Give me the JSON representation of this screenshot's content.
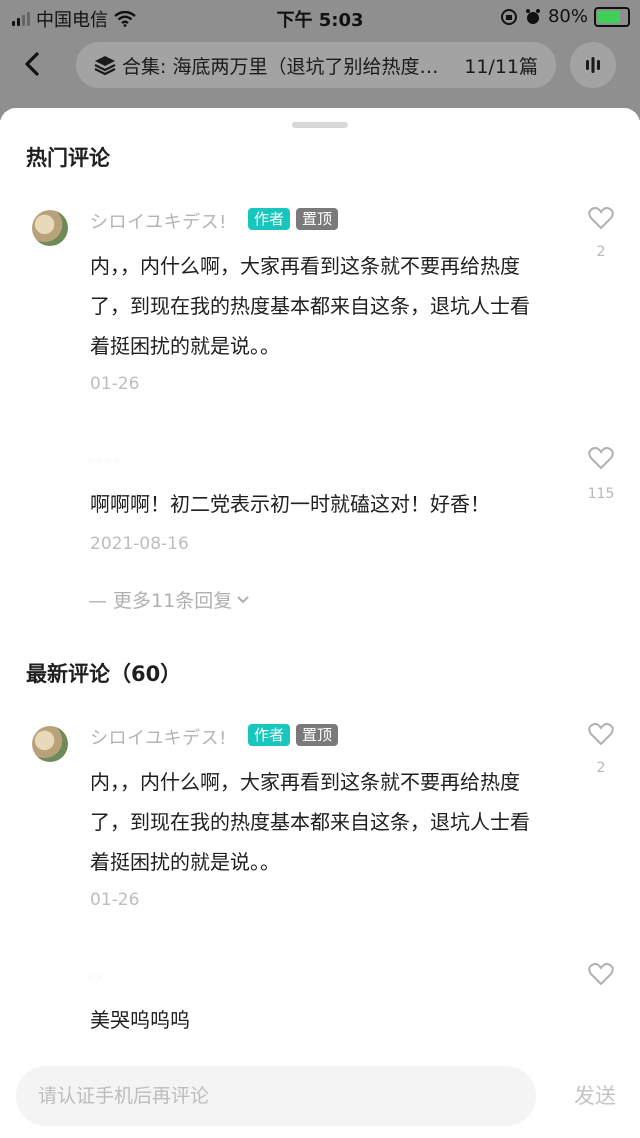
{
  "status_bar": {
    "carrier": "中国电信",
    "time": "下午 5:03",
    "battery_percent": "80%",
    "battery_level": 0.8,
    "icons": [
      "signal-icon",
      "wifi-icon",
      "orientation-lock-icon",
      "alarm-icon",
      "battery-icon"
    ]
  },
  "header": {
    "back_icon": "chevron-left-icon",
    "collection_icon": "stack-icon",
    "collection_title": "合集: 海底两万里（退坑了别给热度…",
    "collection_count": "11/11篇",
    "audio_icon": "audio-bars-icon"
  },
  "hot_comments": {
    "title": "热门评论",
    "items": [
      {
        "username": "シロイユキデス!",
        "badge_author": "作者",
        "badge_pinned": "置顶",
        "text": "内，，内什么啊，大家再看到这条就不要再给热度了，到现在我的热度基本都来自这条，退坑人士看着挺困扰的就是说。。",
        "date": "01-26",
        "likes": "2"
      },
      {
        "text": "啊啊啊！初二党表示初一时就磕这对！好香！",
        "date": "2021-08-16",
        "likes": "115",
        "more_replies": "— 更多11条回复"
      }
    ]
  },
  "latest_comments": {
    "title": "最新评论（60）",
    "items": [
      {
        "username": "シロイユキデス!",
        "badge_author": "作者",
        "badge_pinned": "置顶",
        "text": "内，，内什么啊，大家再看到这条就不要再给热度了，到现在我的热度基本都来自这条，退坑人士看着挺困扰的就是说。。",
        "date": "01-26",
        "likes": "2"
      },
      {
        "text": "美哭呜呜呜"
      }
    ]
  },
  "composer": {
    "placeholder": "请认证手机后再评论",
    "send_label": "发送"
  },
  "colors": {
    "author_badge": "#17c6bd",
    "pinned_badge": "#7a7a7a",
    "backdrop": "#8f8f8f"
  }
}
